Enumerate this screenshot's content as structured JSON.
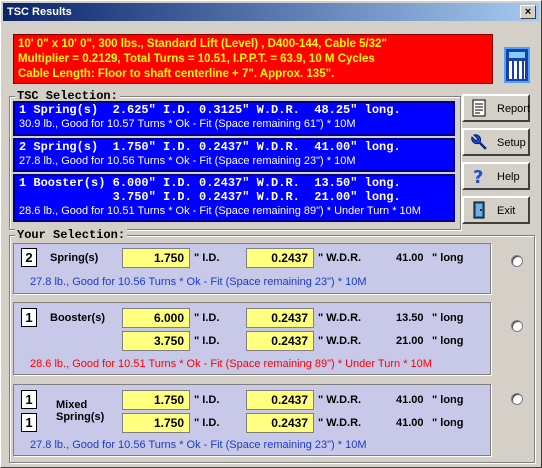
{
  "window": {
    "title": "TSC Results",
    "close_label": "×"
  },
  "header": {
    "lines": [
      "10' 0\" x 10' 0\", 300 lbs., Standard Lift (Level) , D400-144, Cable 5/32\"",
      "Multiplier = 0.2129, Total Turns = 10.51, I.P.P.T. = 63.9, 10 M Cycles",
      "Cable Length: Floor to shaft centerline + 7\". Approx. 135\"."
    ]
  },
  "tsc_selection": {
    "legend": "TSC Selection:",
    "options": [
      {
        "lines": [
          "1 Spring(s)  2.625\" I.D. 0.3125\" W.D.R.  48.25\" long."
        ],
        "sub": "30.9 lb., Good for 10.57 Turns * Ok - Fit (Space remaining 61\") * 10M"
      },
      {
        "lines": [
          "2 Spring(s)  1.750\" I.D. 0.2437\" W.D.R.  41.00\" long."
        ],
        "sub": "27.8 lb., Good for 10.56 Turns * Ok - Fit (Space remaining 23\") * 10M"
      },
      {
        "lines": [
          "1 Booster(s) 6.000\" I.D. 0.2437\" W.D.R.  13.50\" long.",
          "             3.750\" I.D. 0.2437\" W.D.R.  21.00\" long."
        ],
        "sub": "28.6 lb., Good for 10.51 Turns * Ok - Fit (Space remaining 89\") * Under Turn * 10M"
      }
    ]
  },
  "side_buttons": [
    {
      "label": "Report",
      "icon": "report-icon"
    },
    {
      "label": "Setup",
      "icon": "wrench-icon"
    },
    {
      "label": "Help",
      "icon": "help-icon"
    },
    {
      "label": "Exit",
      "icon": "exit-door-icon"
    }
  ],
  "your_selection": {
    "legend": "Your Selection:",
    "units": {
      "id": "\" I.D.",
      "wdr": "\" W.D.R.",
      "long": "\" long"
    },
    "spring": {
      "count": "2",
      "type": "Spring(s)",
      "row": {
        "id": "1.750",
        "wdr": "0.2437",
        "length": "41.00"
      },
      "info": "27.8 lb., Good for 10.56 Turns * Ok - Fit (Space remaining 23\") * 10M",
      "info_color": "#1a3cc8"
    },
    "booster": {
      "count": "1",
      "type": "Booster(s)",
      "rows": [
        {
          "id": "6.000",
          "wdr": "0.2437",
          "length": "13.50"
        },
        {
          "id": "3.750",
          "wdr": "0.2437",
          "length": "21.00"
        }
      ],
      "info": "28.6 lb., Good for 10.51 Turns * Ok - Fit (Space remaining 89\") * Under Turn * 10M",
      "info_color": "#ff0000"
    },
    "mixed": {
      "counts": [
        "1",
        "1"
      ],
      "type_line1": "Mixed",
      "type_line2": "Spring(s)",
      "rows": [
        {
          "id": "1.750",
          "wdr": "0.2437",
          "length": "41.00"
        },
        {
          "id": "1.750",
          "wdr": "0.2437",
          "length": "41.00"
        }
      ],
      "info": "27.8 lb., Good for 10.56 Turns * Ok - Fit (Space remaining 23\") * 10M",
      "info_color": "#1a3cc8"
    }
  }
}
